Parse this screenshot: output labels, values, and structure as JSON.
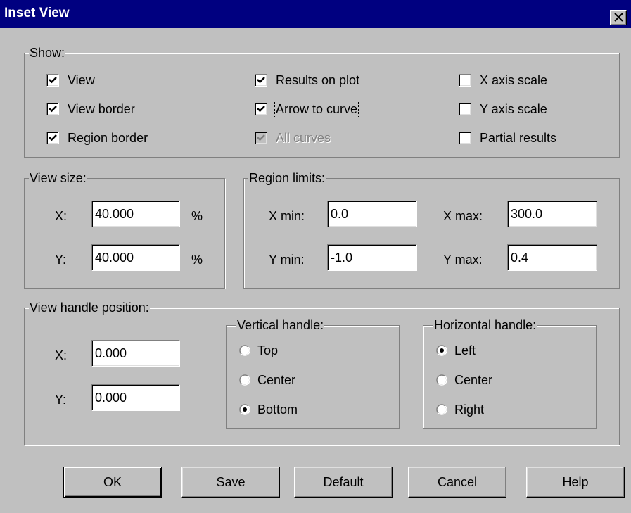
{
  "window": {
    "title": "Inset View",
    "close_icon": "close-icon"
  },
  "show": {
    "legend": "Show:",
    "checkboxes": [
      {
        "id": "view",
        "label": "View",
        "checked": true
      },
      {
        "id": "view-border",
        "label": "View border",
        "checked": true
      },
      {
        "id": "region-border",
        "label": "Region border",
        "checked": true
      },
      {
        "id": "results-on-plot",
        "label": "Results on plot",
        "checked": true
      },
      {
        "id": "arrow-to-curve",
        "label": "Arrow to curve",
        "checked": true,
        "focused": true
      },
      {
        "id": "all-curves",
        "label": "All curves",
        "checked": true,
        "disabled": true
      },
      {
        "id": "x-axis-scale",
        "label": "X axis scale",
        "checked": false
      },
      {
        "id": "y-axis-scale",
        "label": "Y axis scale",
        "checked": false
      },
      {
        "id": "partial-results",
        "label": "Partial results",
        "checked": false
      }
    ]
  },
  "view_size": {
    "legend": "View size:",
    "x_label": "X:",
    "x_value": "40.000",
    "x_unit": "%",
    "y_label": "Y:",
    "y_value": "40.000",
    "y_unit": "%"
  },
  "region_limits": {
    "legend": "Region limits:",
    "xmin_label": "X min:",
    "xmin_value": "0.0",
    "xmax_label": "X max:",
    "xmax_value": "300.0",
    "ymin_label": "Y min:",
    "ymin_value": "-1.0",
    "ymax_label": "Y max:",
    "ymax_value": "0.4"
  },
  "handle_position": {
    "legend": "View handle position:",
    "x_label": "X:",
    "x_value": "0.000",
    "y_label": "Y:",
    "y_value": "0.000",
    "vertical": {
      "legend": "Vertical handle:",
      "options": [
        "Top",
        "Center",
        "Bottom"
      ],
      "selected": "Bottom"
    },
    "horizontal": {
      "legend": "Horizontal handle:",
      "options": [
        "Left",
        "Center",
        "Right"
      ],
      "selected": "Left"
    }
  },
  "buttons": {
    "ok": "OK",
    "save": "Save",
    "default": "Default",
    "cancel": "Cancel",
    "help": "Help"
  },
  "colors": {
    "title_bar": "#000080",
    "face": "#c0c0c0"
  }
}
